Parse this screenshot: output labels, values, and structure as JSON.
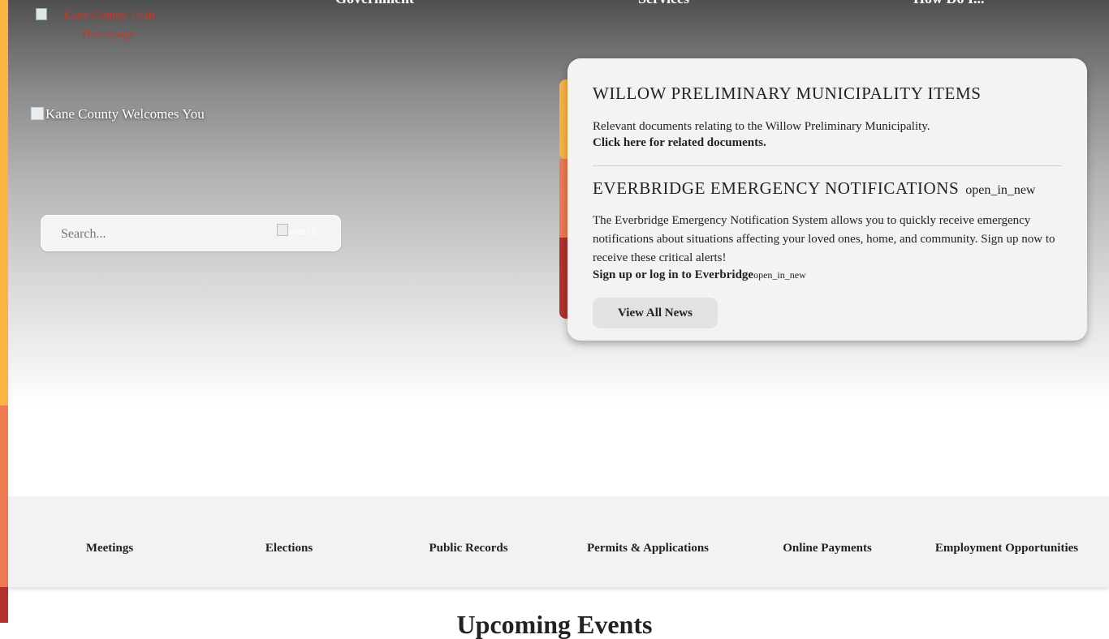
{
  "logo": {
    "alt": "Kane County Utah Homepage"
  },
  "nav": [
    "Government",
    "Services",
    "How Do I..."
  ],
  "hero": {
    "welcome_alt": "Kane County Welcomes You"
  },
  "search": {
    "placeholder": "Search...",
    "button_alt": "search"
  },
  "news": {
    "item1_title": "WILLOW PRELIMINARY MUNICIPALITY ITEMS",
    "item1_text": "Relevant documents relating to the Willow Preliminary Municipality.",
    "item1_link": "Click here for related documents.",
    "item2_title": "EVERBRIDGE EMERGENCY NOTIFICATIONS",
    "item2_title_icon": "open_in_new",
    "item2_text": "The Everbridge Emergency Notification System allows you to quickly receive emergency notifications about situations affecting your loved ones, home, and community. Sign up now to receive these critical alerts!",
    "item2_link": "Sign up or log in to Everbridge",
    "item2_link_icon": "open_in_new",
    "view_all": "View All News"
  },
  "quick_links": [
    "Meetings",
    "Elections",
    "Public Records",
    "Permits & Applications",
    "Online Payments",
    "Employment Opportunities"
  ],
  "upcoming_title": "Upcoming Events",
  "colors": {
    "accent_yellow": "#f9b441",
    "accent_orange": "#ef7a52",
    "accent_red": "#b1322d"
  }
}
